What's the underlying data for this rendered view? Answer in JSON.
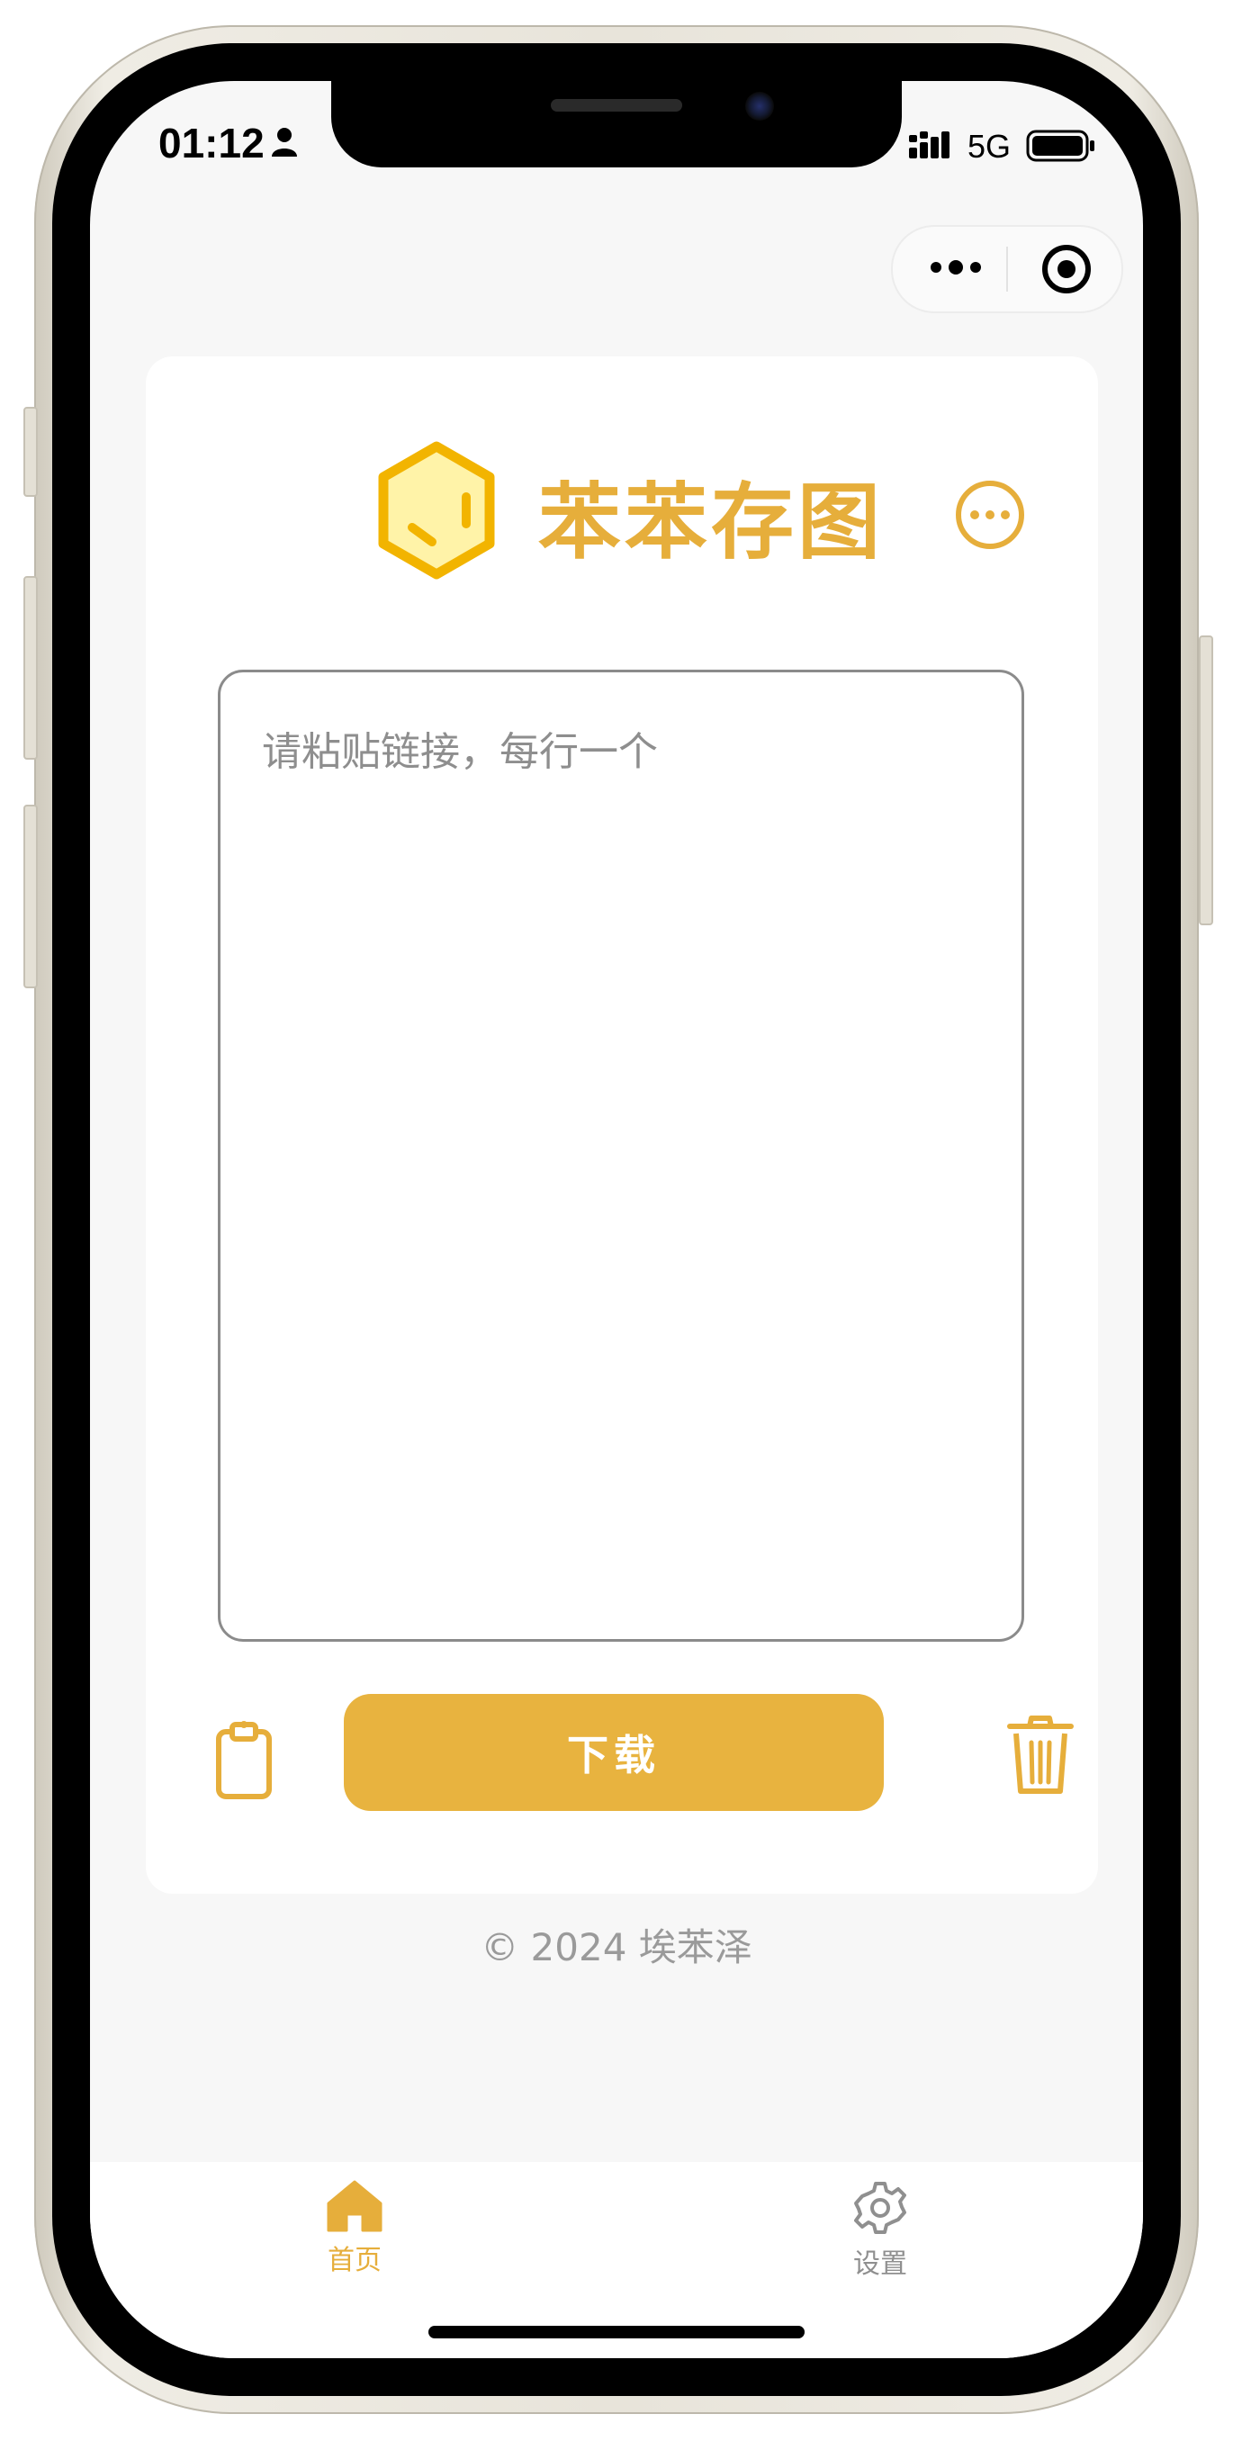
{
  "status_bar": {
    "time": "01:12",
    "network": "5G",
    "icons": [
      "person-icon",
      "signal-icon",
      "battery-icon"
    ]
  },
  "capsule": {
    "icons": [
      "more-dots-icon",
      "target-icon"
    ]
  },
  "header": {
    "title": "苯苯存图",
    "logo_icon": "hexagon-logo-icon",
    "menu_icon": "more-circle-icon"
  },
  "main": {
    "input_value": "",
    "input_placeholder": "请粘贴链接，每行一个",
    "paste_icon": "clipboard-icon",
    "download_label": "下载",
    "clear_icon": "trash-icon"
  },
  "footer": {
    "copyright": "© 2024 埃苯泽"
  },
  "tabbar": {
    "tabs": [
      {
        "label": "首页",
        "icon": "home-icon",
        "active": true
      },
      {
        "label": "设置",
        "icon": "gear-icon",
        "active": false
      }
    ]
  },
  "colors": {
    "accent": "#e8b33f",
    "title": "#e6ae3b",
    "inactive": "#8f8f8f",
    "background": "#f7f7f7"
  }
}
